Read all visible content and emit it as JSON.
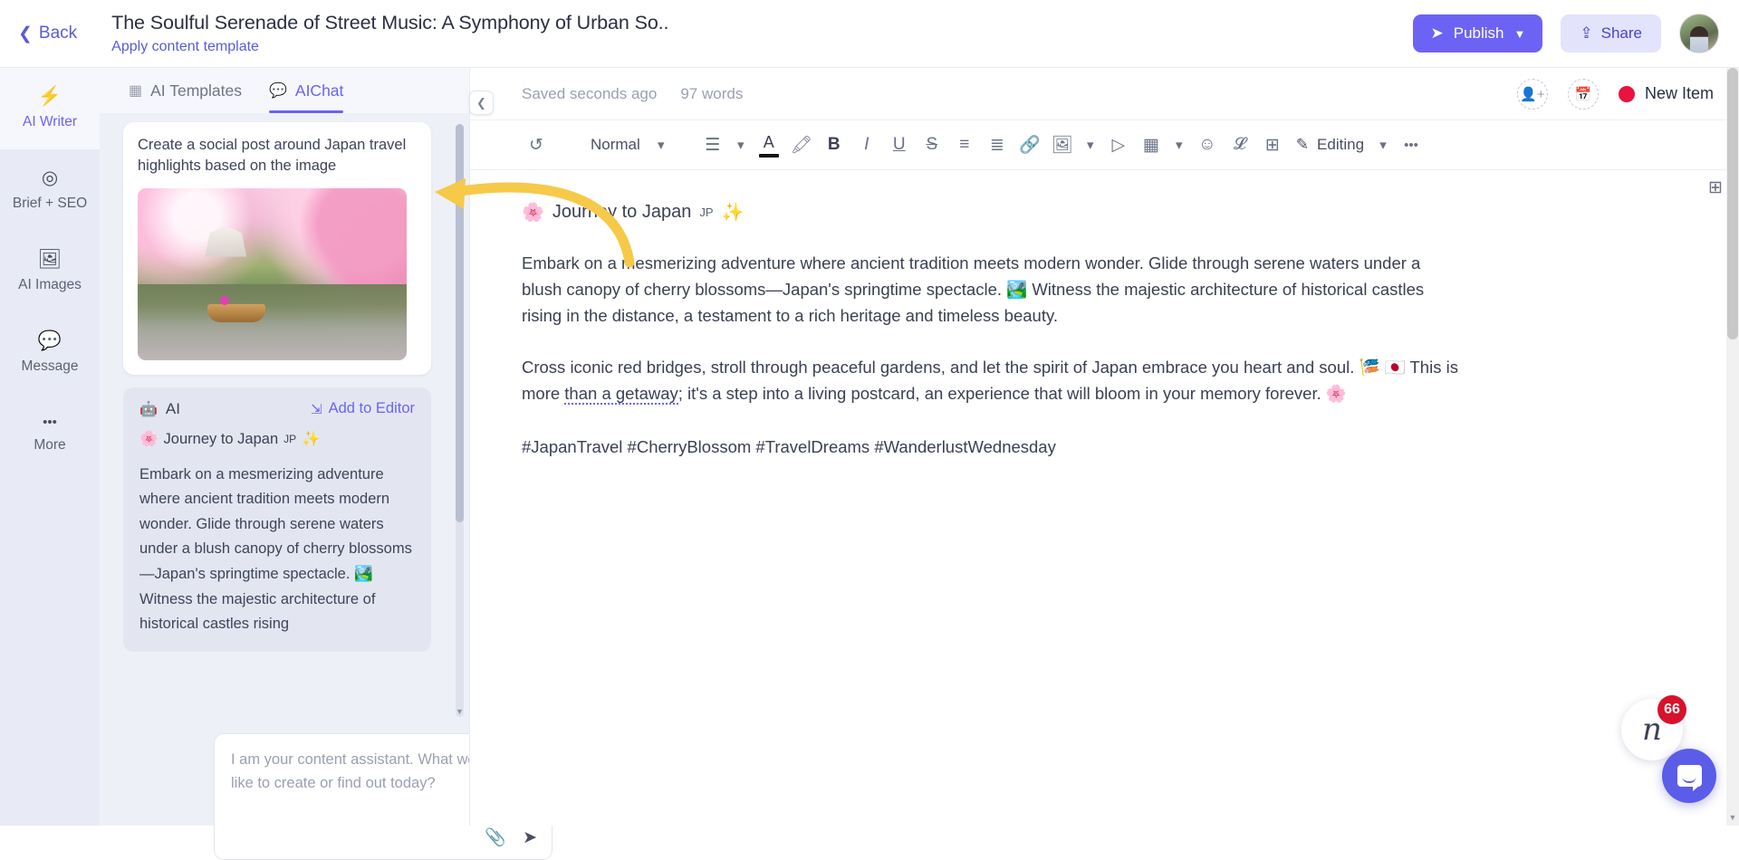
{
  "header": {
    "back_label": "Back",
    "doc_title": "The Soulful Serenade of Street Music: A Symphony of Urban So..",
    "template_link": "Apply content template",
    "publish_label": "Publish",
    "share_label": "Share",
    "accent_color": "#6c63f4"
  },
  "rail": {
    "items": [
      {
        "label": "AI Writer",
        "icon": "lightning-icon",
        "glyph": "⚡",
        "active": true
      },
      {
        "label": "Brief + SEO",
        "icon": "target-icon",
        "glyph": "⌖",
        "active": false
      },
      {
        "label": "AI Images",
        "icon": "image-icon",
        "glyph": "🖼",
        "active": false
      },
      {
        "label": "Message",
        "icon": "message-icon",
        "glyph": "💬",
        "active": false
      },
      {
        "label": "More",
        "icon": "ellipsis-icon",
        "glyph": "•••",
        "active": false
      }
    ]
  },
  "chat": {
    "tabs": [
      {
        "label": "AI Templates",
        "icon": "templates-icon",
        "glyph": "‖",
        "active": false
      },
      {
        "label": "AIChat",
        "icon": "chat-bubbles-icon",
        "glyph": "💬",
        "active": true
      }
    ],
    "user_message": "Create a social post around Japan travel highlights based on the image",
    "user_image_alt": "cherry-blossom-castle-boat-photo",
    "ai_label": "AI",
    "add_to_editor_label": "Add to Editor",
    "ai_heading": "Journey to Japan",
    "ai_heading_sub": "JP",
    "ai_heading_emoji_left": "🌸",
    "ai_heading_emoji_right": "✨",
    "ai_body": "Embark on a mesmerizing adventure where ancient tradition meets modern wonder. Glide through serene waters under a blush canopy of cherry blossoms—Japan's springtime spectacle. 🏞️ Witness the majestic architecture of historical castles rising",
    "input_placeholder": "I am your content assistant. What would you like to create or find out today?",
    "attach_icon": "paperclip-icon",
    "send_icon": "send-icon"
  },
  "editor": {
    "saved_status": "Saved seconds ago",
    "word_count": "97 words",
    "invite_icon": "add-person-icon",
    "schedule_icon": "calendar-add-icon",
    "status_label": "New Item",
    "status_color": "#e8133f",
    "toolbar": {
      "undo_icon": "undo-icon",
      "style_label": "Normal",
      "align_icon": "align-icon",
      "text_color_icon": "text-color-icon",
      "highlight_icon": "highlighter-icon",
      "bold_label": "B",
      "italic_label": "I",
      "underline_label": "U",
      "strike_label": "S",
      "bullet_list_icon": "bullet-list-icon",
      "numbered_list_icon": "numbered-list-icon",
      "link_icon": "link-icon",
      "image_icon": "image-icon",
      "media_icon": "play-icon",
      "table_icon": "table-icon",
      "emoji_icon": "emoji-icon",
      "clear-format_icon": "clear-format-icon",
      "comment_icon": "add-comment-icon",
      "mode_icon": "pencil-icon",
      "mode_label": "Editing",
      "more_icon": "ellipsis-icon"
    },
    "document": {
      "heading": "Journey to Japan",
      "heading_sub": "JP",
      "heading_emoji_left": "🌸",
      "heading_emoji_right": "✨",
      "paragraph_1": "Embark on a mesmerizing adventure where ancient tradition meets modern wonder. Glide through serene waters under a blush canopy of cherry blossoms—Japan's springtime spectacle. 🏞️ Witness the majestic architecture of historical castles rising in the distance, a testament to a rich heritage and timeless beauty.",
      "paragraph_2_a": "Cross iconic red bridges, stroll through peaceful gardens, and let the spirit of Japan embrace you heart and soul. 🎏 🇯🇵 This is more ",
      "paragraph_2_spell": "than a getaway",
      "paragraph_2_b": "; it's a step into a living postcard, an experience that will bloom in your memory forever. 🌸",
      "hashtags": "#JapanTravel #CherryBlossom #TravelDreams #WanderlustWednesday",
      "comment_icon": "add-comment-icon"
    }
  },
  "floating": {
    "logo_mark": "n",
    "notification_count": "66",
    "chat_widget_icon": "intercom-chat-icon"
  }
}
